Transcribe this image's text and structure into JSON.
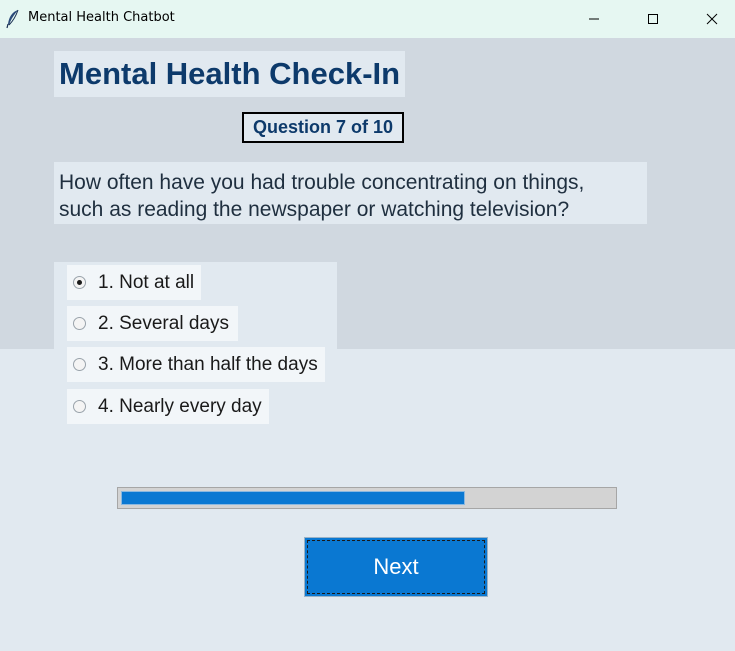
{
  "window": {
    "title": "Mental Health Chatbot",
    "app_icon": "feather-icon",
    "controls": [
      "minimize-icon",
      "maximize-icon",
      "close-icon"
    ]
  },
  "main": {
    "heading": "Mental Health Check-In",
    "question_counter": "Question 7 of 10",
    "question_lines": [
      "How often have you had trouble concentrating on things,",
      "such as reading the newspaper or watching television?"
    ],
    "options": [
      {
        "label": "1. Not at all",
        "selected": true
      },
      {
        "label": "2. Several days",
        "selected": false
      },
      {
        "label": "3. More than half the days",
        "selected": false
      },
      {
        "label": "4. Nearly every day",
        "selected": false
      }
    ],
    "progress_fraction": 0.7,
    "next_label": "Next"
  },
  "colors": {
    "accent": "#0a78d2",
    "heading": "#0d3a6b",
    "titlebar": "#e6f7f2"
  }
}
